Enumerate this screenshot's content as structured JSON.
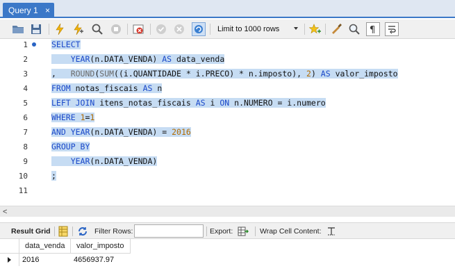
{
  "tab": {
    "title": "Query 1",
    "close": "×"
  },
  "toolbar": {
    "limit_label": "Limit to 1000 rows"
  },
  "editor": {
    "line_numbers": [
      "1",
      "2",
      "3",
      "4",
      "5",
      "6",
      "7",
      "8",
      "9",
      "10",
      "11"
    ],
    "lines": [
      [
        {
          "t": "SELECT",
          "c": "kw"
        }
      ],
      [
        {
          "t": "    YEAR",
          "c": "kw"
        },
        {
          "t": "(n.DATA_VENDA) ",
          "c": ""
        },
        {
          "t": "AS",
          "c": "kw"
        },
        {
          "t": " data_venda",
          "c": ""
        }
      ],
      [
        {
          "t": ",   ",
          "c": ""
        },
        {
          "t": "ROUND",
          "c": "fn"
        },
        {
          "t": "(",
          "c": ""
        },
        {
          "t": "SUM",
          "c": "fn"
        },
        {
          "t": "((i.QUANTIDADE * i.PRECO) * n.imposto), ",
          "c": ""
        },
        {
          "t": "2",
          "c": "num"
        },
        {
          "t": ") ",
          "c": ""
        },
        {
          "t": "AS",
          "c": "kw"
        },
        {
          "t": " valor_imposto",
          "c": ""
        }
      ],
      [
        {
          "t": "FROM",
          "c": "kw"
        },
        {
          "t": " notas_fiscais ",
          "c": ""
        },
        {
          "t": "AS",
          "c": "kw"
        },
        {
          "t": " n",
          "c": ""
        }
      ],
      [
        {
          "t": "LEFT JOIN",
          "c": "kw"
        },
        {
          "t": " itens_notas_fiscais ",
          "c": ""
        },
        {
          "t": "AS",
          "c": "kw"
        },
        {
          "t": " i ",
          "c": ""
        },
        {
          "t": "ON",
          "c": "kw"
        },
        {
          "t": " n.NUMERO = i.numero",
          "c": ""
        }
      ],
      [
        {
          "t": "WHERE",
          "c": "kw"
        },
        {
          "t": " ",
          "c": ""
        },
        {
          "t": "1",
          "c": "num"
        },
        {
          "t": "=",
          "c": ""
        },
        {
          "t": "1",
          "c": "num"
        }
      ],
      [
        {
          "t": "AND",
          "c": "kw"
        },
        {
          "t": " ",
          "c": ""
        },
        {
          "t": "YEAR",
          "c": "kw"
        },
        {
          "t": "(n.DATA_VENDA) = ",
          "c": ""
        },
        {
          "t": "2016",
          "c": "num"
        }
      ],
      [
        {
          "t": "GROUP BY",
          "c": "kw"
        }
      ],
      [
        {
          "t": "    YEAR",
          "c": "kw"
        },
        {
          "t": "(n.DATA_VENDA)",
          "c": ""
        }
      ],
      [
        {
          "t": ";",
          "c": ""
        }
      ],
      []
    ]
  },
  "result_bar": {
    "result_grid": "Result Grid",
    "filter_rows": "Filter Rows:",
    "filter_value": "",
    "export": "Export:",
    "wrap_cell": "Wrap Cell Content:"
  },
  "grid": {
    "columns": [
      "data_venda",
      "valor_imposto"
    ],
    "rows": [
      [
        "2016",
        "4656937.97"
      ]
    ]
  },
  "colors": {
    "accent": "#3b78c8",
    "selection": "#c6dcf3",
    "keyword": "#1a48c9"
  }
}
